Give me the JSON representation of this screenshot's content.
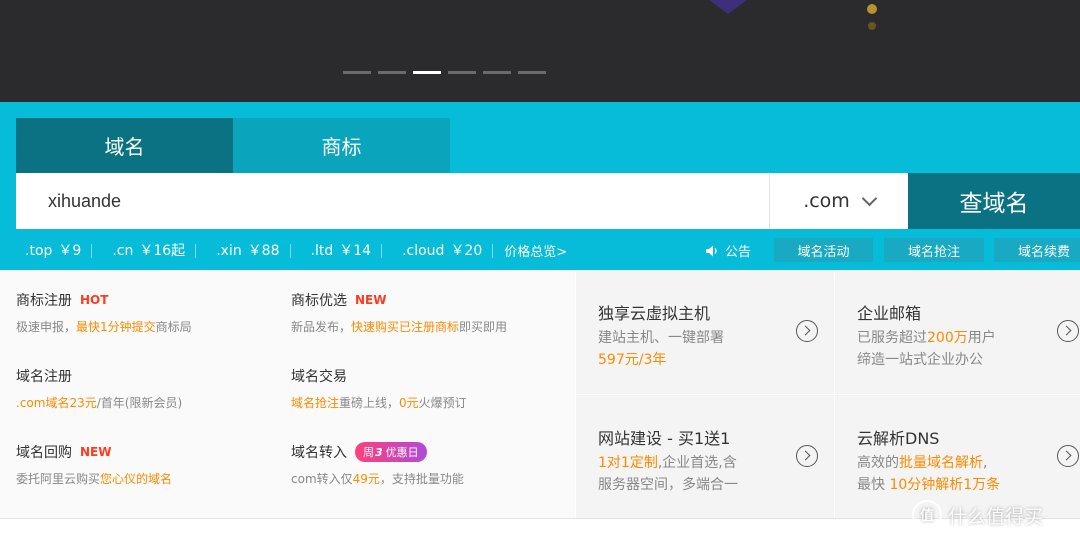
{
  "carousel": {
    "count": 6,
    "active_index": 2
  },
  "tabs": [
    {
      "label": "域名",
      "active": true
    },
    {
      "label": "商标",
      "active": false
    }
  ],
  "search": {
    "value": "xihuande",
    "tld": ".com",
    "button_label": "查域名"
  },
  "prices": [
    {
      "tld": ".top",
      "price": "￥9"
    },
    {
      "tld": ".cn",
      "price": "￥16起"
    },
    {
      "tld": ".xin",
      "price": "￥88"
    },
    {
      "tld": ".ltd",
      "price": "￥14"
    },
    {
      "tld": ".cloud",
      "price": "￥20"
    }
  ],
  "price_overview": "价格总览>",
  "announce": "公告",
  "band_buttons": [
    "域名活动",
    "域名抢注",
    "域名续费"
  ],
  "services": [
    {
      "title": "商标注册",
      "tag": "HOT",
      "desc": [
        "极速申报，",
        "最快1分钟提交",
        "商标局"
      ]
    },
    {
      "title": "商标优选",
      "tag": "NEW",
      "desc": [
        "新品发布，",
        "快速购买已注册商标",
        "即买即用"
      ]
    },
    {
      "title": "域名注册",
      "tag": "",
      "desc": [
        "",
        ".com域名23元",
        "/首年(限新会员)"
      ]
    },
    {
      "title": "域名交易",
      "tag": "",
      "desc": [
        "",
        "域名抢注",
        "重磅上线，",
        "0元",
        "火爆预订"
      ]
    },
    {
      "title": "域名回购",
      "tag": "NEW",
      "desc": [
        "委托阿里云购买",
        "您心仪的域名",
        ""
      ]
    },
    {
      "title": "域名转入",
      "pill_a": "周",
      "pill_b": "3",
      "pill_c": "优惠日",
      "desc": [
        "com转入仅",
        "49元",
        "，支持批量功能"
      ]
    }
  ],
  "cards": [
    {
      "title": "独享云虚拟主机",
      "line1": "建站主机、一键部署",
      "line2_hl": "597元/3年",
      "line2": ""
    },
    {
      "title": "企业邮箱",
      "line1_a": "已服务超过",
      "line1_hl": "200万",
      "line1_b": "用户",
      "line2": "缔造一站式企业办公"
    },
    {
      "title": "网站建设 - 买1送1",
      "line1_hl": "1对1定制",
      "line1_b": ",企业首选,含",
      "line2": "服务器空间，多端合一"
    },
    {
      "title": "云解析DNS",
      "line1_a": "高效的",
      "line1_hl": "批量域名解析",
      "line1_b": ",",
      "line2_a": "最快 ",
      "line2_hl": "10分钟解析1万条",
      "line2_b": ""
    }
  ],
  "watermark": {
    "icon": "值",
    "text": "什么值得买"
  },
  "colors": {
    "band": "#06bcd8",
    "dark_teal": "#0a7283",
    "highlight": "#ff8a00",
    "hot": "#ff3b1f"
  }
}
